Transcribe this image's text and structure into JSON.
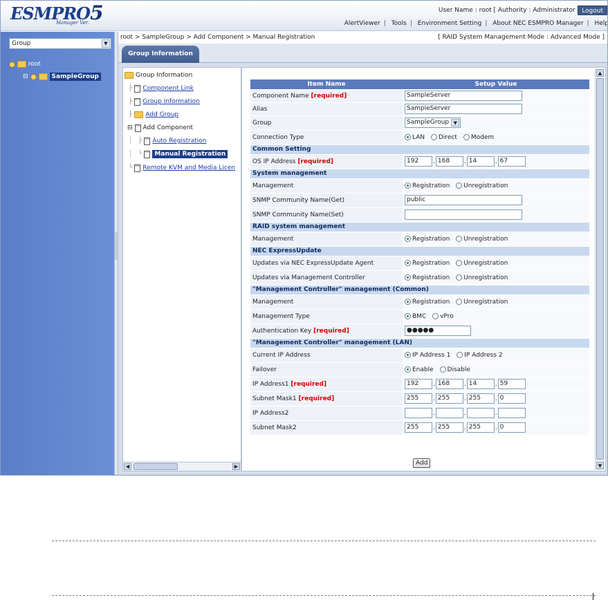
{
  "header": {
    "logo_text": "ESMPRO",
    "logo_number": "5",
    "logo_sub": "Manager Ver.",
    "user_info": "User Name : root  [ Authority : Administrator ]",
    "logout": "Logout",
    "menu": [
      "AlertViewer",
      "Tools",
      "Environment Setting",
      "About NEC ESMPRO Manager",
      "Help"
    ]
  },
  "left": {
    "group_select": "Group",
    "tree": [
      {
        "label": "root"
      },
      {
        "label": "SampleGroup"
      }
    ]
  },
  "breadcrumb": "root > SampleGroup > Add Component > Manual Registration",
  "mode": "[ RAID System Management Mode : Advanced Mode ]",
  "tab": "Group Information",
  "tree2": {
    "root": "Group Information",
    "items": [
      "Component Link",
      "Group Information",
      "Add Group",
      "Add Component",
      "Auto Registration",
      "Manual Registration",
      "Remote KVM and Media Licen"
    ]
  },
  "form": {
    "col_item": "Item Name",
    "col_value": "Setup Value",
    "required": "[required]",
    "component_name": {
      "label": "Component Name",
      "value": "SampleServer"
    },
    "alias": {
      "label": "Alias",
      "value": "SampleServer"
    },
    "group": {
      "label": "Group",
      "value": "SampleGroup"
    },
    "connection_type": {
      "label": "Connection Type",
      "options": [
        "LAN",
        "Direct",
        "Modem"
      ],
      "selected": "LAN"
    },
    "sec_common": "Common Setting",
    "os_ip": {
      "label": "OS IP Address",
      "octets": [
        "192",
        "168",
        "14",
        "67"
      ]
    },
    "sec_system": "System management",
    "sys_management": {
      "label": "Management",
      "options": [
        "Registration",
        "Unregistration"
      ],
      "selected": "Registration"
    },
    "snmp_get": {
      "label": "SNMP Community Name(Get)",
      "value": "public"
    },
    "snmp_set": {
      "label": "SNMP Community Name(Set)",
      "value": ""
    },
    "sec_raid": "RAID system management",
    "raid_management": {
      "label": "Management",
      "options": [
        "Registration",
        "Unregistration"
      ],
      "selected": "Registration"
    },
    "sec_express": "NEC ExpressUpdate",
    "eu_agent": {
      "label": "Updates via NEC ExpressUpdate Agent",
      "options": [
        "Registration",
        "Unregistration"
      ],
      "selected": "Registration"
    },
    "eu_mc": {
      "label": "Updates via Management Controller",
      "options": [
        "Registration",
        "Unregistration"
      ],
      "selected": "Registration"
    },
    "sec_mc_common": "\"Management Controller\" management (Common)",
    "mc_management": {
      "label": "Management",
      "options": [
        "Registration",
        "Unregistration"
      ],
      "selected": "Registration"
    },
    "mc_type": {
      "label": "Management Type",
      "options": [
        "BMC",
        "vPro"
      ],
      "selected": "BMC"
    },
    "auth_key": {
      "label": "Authentication Key",
      "value": "●●●●●"
    },
    "sec_mc_lan": "\"Management Controller\" management (LAN)",
    "current_ip": {
      "label": "Current IP Address",
      "options": [
        "IP Address 1",
        "IP Address 2"
      ],
      "selected": "IP Address 1"
    },
    "failover": {
      "label": "Failover",
      "options": [
        "Enable",
        "Disable"
      ],
      "selected": "Enable"
    },
    "ip1": {
      "label": "IP Address1",
      "octets": [
        "192",
        "168",
        "14",
        "59"
      ]
    },
    "mask1": {
      "label": "Subnet Mask1",
      "octets": [
        "255",
        "255",
        "255",
        "0"
      ]
    },
    "ip2": {
      "label": "IP Address2",
      "octets": [
        "",
        "",
        "",
        ""
      ]
    },
    "mask2": {
      "label": "Subnet Mask2",
      "octets": [
        "255",
        "255",
        "255",
        "0"
      ]
    },
    "add_button": "Add"
  }
}
